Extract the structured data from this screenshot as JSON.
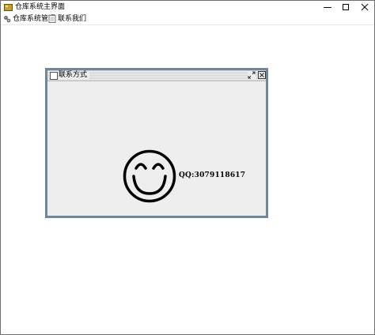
{
  "window": {
    "title": "仓库系统主界面",
    "icon": "warehouse-app-icon",
    "controls": {
      "minimize_icon": "minimize-icon",
      "maximize_icon": "maximize-icon",
      "close_icon": "close-icon"
    }
  },
  "menubar": {
    "items": [
      {
        "label": "仓库系统管理",
        "icon": "gears-icon"
      },
      {
        "label": "联系我们",
        "icon": "document-icon"
      }
    ]
  },
  "internal_frame": {
    "title": "联系方式",
    "icon": "frame-icon",
    "controls": {
      "restore_icon": "restore-icon",
      "close_icon": "close-box-icon"
    },
    "content": {
      "image": "smiley-face-icon",
      "contact_text": "QQ:3079118617"
    }
  },
  "colors": {
    "frame_border": "#72869a",
    "frame_background": "#eeeeee",
    "desktop_background": "#ffffff"
  }
}
